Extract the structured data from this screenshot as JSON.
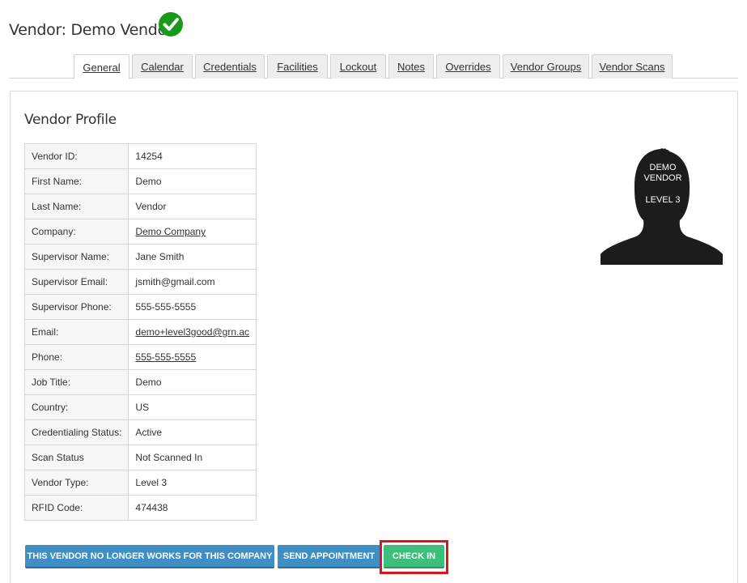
{
  "header": {
    "title": "Vendor: Demo Vendor",
    "status_icon": "check-circle-icon",
    "status_color": "#1a9a1a"
  },
  "tabs": [
    {
      "label": "General",
      "active": true
    },
    {
      "label": "Calendar"
    },
    {
      "label": "Credentials"
    },
    {
      "label": "Facilities"
    },
    {
      "label": "Lockout"
    },
    {
      "label": "Notes"
    },
    {
      "label": "Overrides"
    },
    {
      "label": "Vendor Groups"
    },
    {
      "label": "Vendor Scans"
    }
  ],
  "profile": {
    "title": "Vendor Profile",
    "rows": [
      {
        "label": "Vendor ID:",
        "value": "14254"
      },
      {
        "label": "First Name:",
        "value": "Demo"
      },
      {
        "label": "Last Name:",
        "value": "Vendor"
      },
      {
        "label": "Company:",
        "value": "Demo Company",
        "link": true
      },
      {
        "label": "Supervisor Name:",
        "value": "Jane Smith"
      },
      {
        "label": "Supervisor Email:",
        "value": "jsmith@gmail.com"
      },
      {
        "label": "Supervisor Phone:",
        "value": "555-555-5555"
      },
      {
        "label": "Email:",
        "value": "demo+level3good@grn.ac",
        "link": true
      },
      {
        "label": "Phone:",
        "value": "555-555-5555",
        "link": true
      },
      {
        "label": "Job Title:",
        "value": "Demo"
      },
      {
        "label": "Country:",
        "value": "US"
      },
      {
        "label": "Credentialing Status:",
        "value": "Active"
      },
      {
        "label": "Scan Status",
        "value": "Not Scanned In"
      },
      {
        "label": "Vendor Type:",
        "value": "Level 3"
      },
      {
        "label": "RFID Code:",
        "value": "474438"
      }
    ]
  },
  "avatar": {
    "line1": "DEMO",
    "line2": "VENDOR",
    "line3": "LEVEL 3"
  },
  "actions": {
    "no_longer_works": "THIS VENDOR NO LONGER WORKS FOR THIS COMPANY",
    "send_appointment": "SEND APPOINTMENT",
    "check_in": "CHECK IN"
  },
  "colors": {
    "button_blue": "#3f8fc4",
    "button_green": "#3bbf7a",
    "highlight": "#d9171e"
  }
}
